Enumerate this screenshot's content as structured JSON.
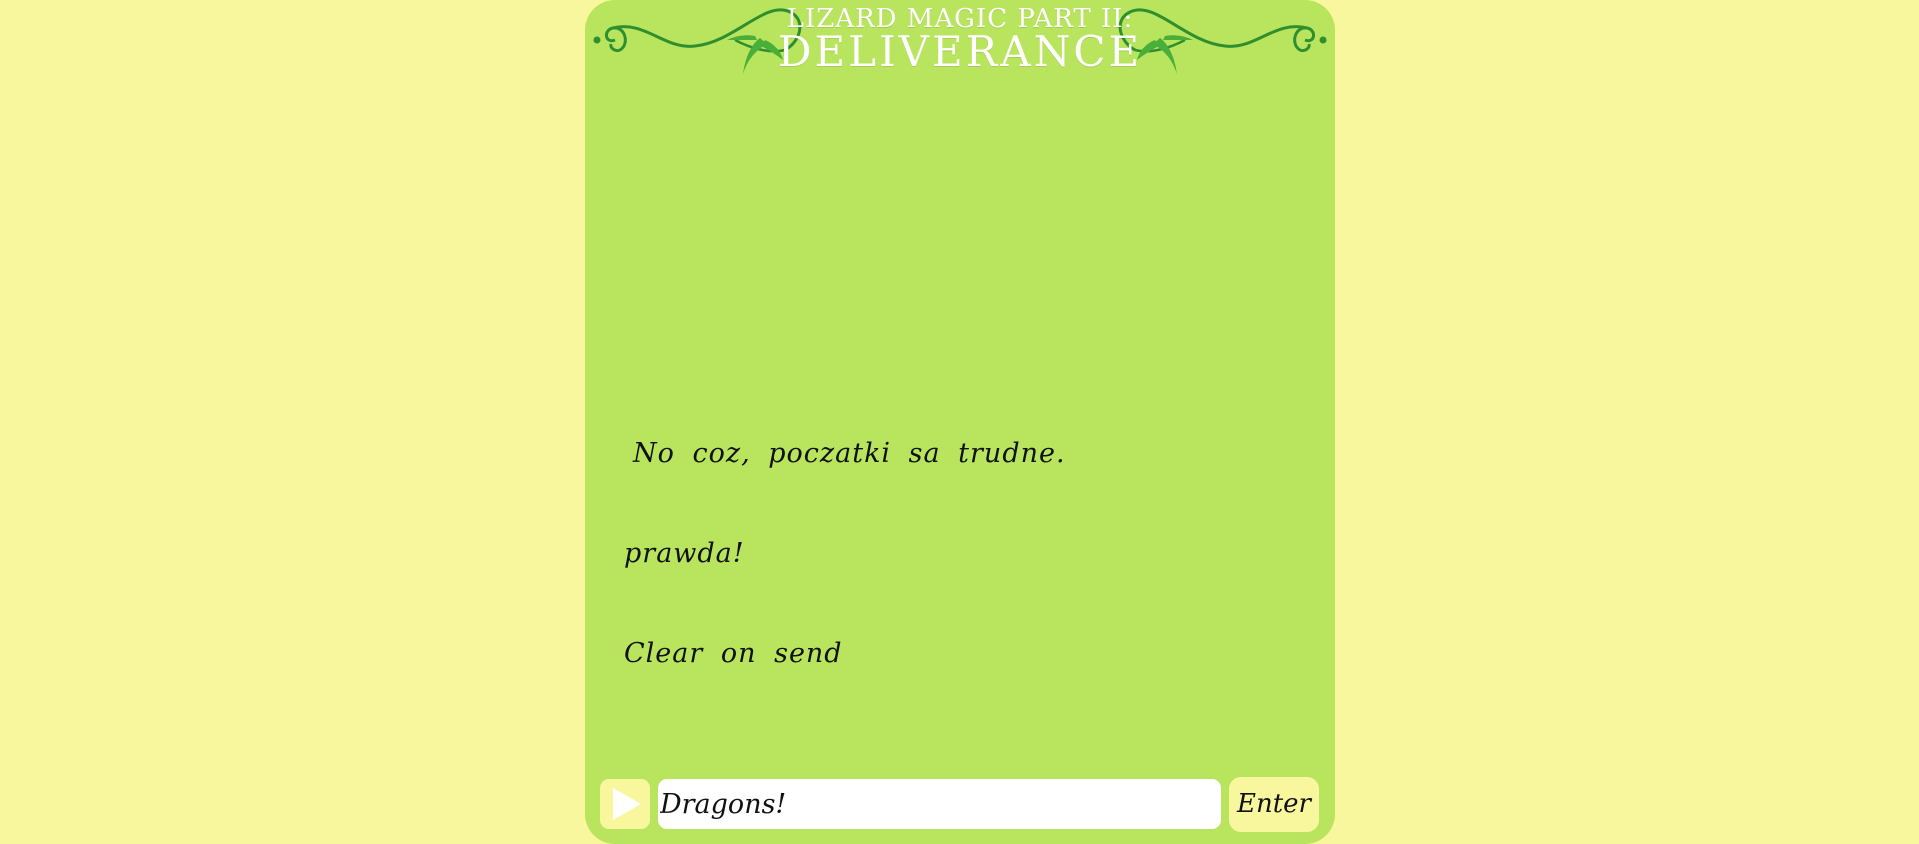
{
  "header": {
    "title_line1": "LIZARD MAGIC PART II:",
    "title_line2": "DELIVERANCE",
    "ornament_color": "#2f8f2f",
    "leaf_color": "#4aae3a",
    "title_color": "#ffffff"
  },
  "messages": [
    "No coz, poczatki sa trudne.",
    "prawda!",
    "Clear on send"
  ],
  "input": {
    "value": "Dragons!"
  },
  "buttons": {
    "play_icon": "play-icon",
    "enter_label": "Enter"
  },
  "colors": {
    "background": "#f8f79d",
    "panel": "#b9e55e",
    "input_bg": "#ffffff",
    "button_bg": "#f8f79d"
  }
}
